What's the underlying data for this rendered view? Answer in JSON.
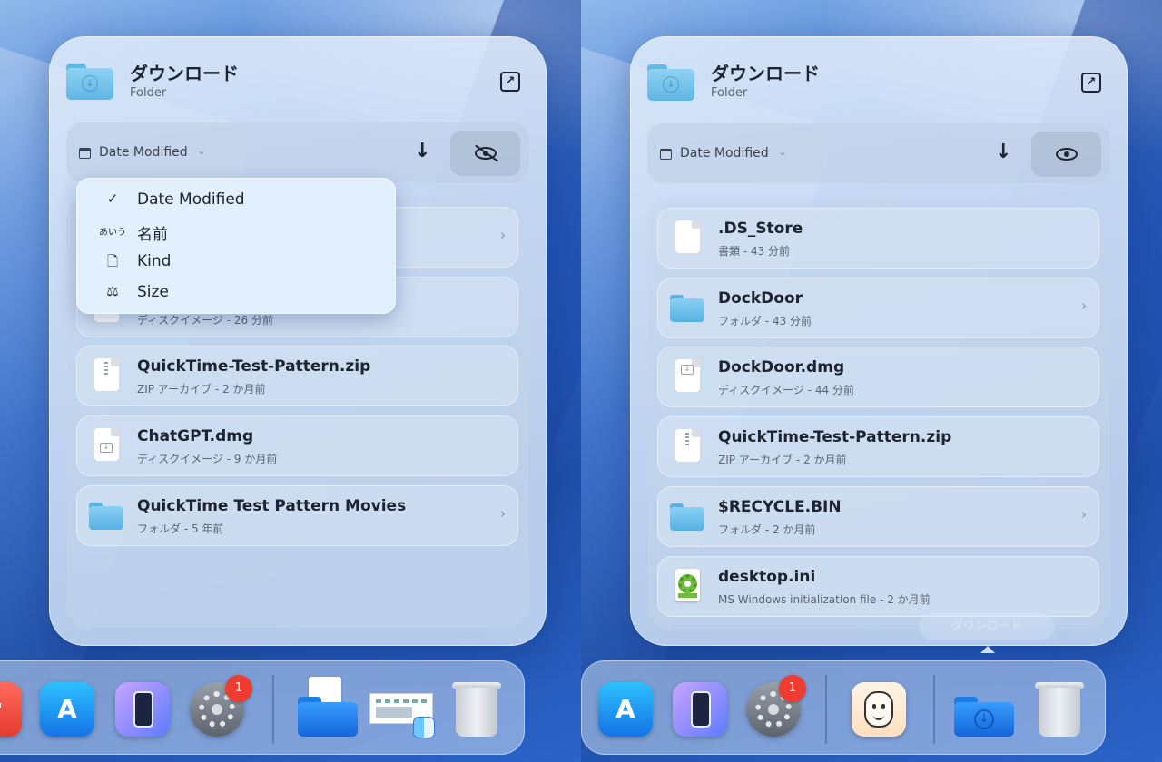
{
  "left": {
    "panel": {
      "title": "ダウンロード",
      "subtitle": "Folder",
      "open_icon": "open-in-finder-icon"
    },
    "toolbar": {
      "sort_label": "Date Modified",
      "sort_direction_glyph": "↓",
      "visibility_icon": "eye-slash-icon"
    },
    "sort_menu": {
      "items": [
        {
          "glyph": "✓",
          "label": "Date Modified",
          "icon": "checkmark-icon",
          "selected": true
        },
        {
          "glyph": "あいう",
          "label": "名前",
          "icon": "hiragana-icon"
        },
        {
          "glyph": "🗋",
          "label": "Kind",
          "icon": "document-icon"
        },
        {
          "glyph": "⚖",
          "label": "Size",
          "icon": "weight-icon"
        }
      ]
    },
    "files": [
      {
        "name": "",
        "meta": "",
        "icon": "hidden-row",
        "has_chevron": true
      },
      {
        "name": "",
        "meta": "ディスクイメージ - 26 分前",
        "icon": "disk-image-icon",
        "has_chevron": false
      },
      {
        "name": "QuickTime-Test-Pattern.zip",
        "meta": "ZIP アーカイブ - 2 か月前",
        "icon": "zip-file-icon",
        "has_chevron": false
      },
      {
        "name": "ChatGPT.dmg",
        "meta": "ディスクイメージ - 9 か月前",
        "icon": "disk-image-icon",
        "has_chevron": false
      },
      {
        "name": "QuickTime Test Pattern Movies",
        "meta": "フォルダ - 5 年前",
        "icon": "folder-icon",
        "has_chevron": true
      }
    ],
    "dock": {
      "items": [
        "rocket-app-icon",
        "app-store-icon",
        "iphone-mirroring-icon",
        "system-settings-icon",
        "downloads-stack-icon",
        "screenshot-stack-icon",
        "trash-icon"
      ],
      "settings_badge": "1"
    }
  },
  "right": {
    "panel": {
      "title": "ダウンロード",
      "subtitle": "Folder",
      "open_icon": "open-in-finder-icon"
    },
    "toolbar": {
      "sort_label": "Date Modified",
      "sort_direction_glyph": "↓",
      "visibility_icon": "eye-icon"
    },
    "files": [
      {
        "name": ".DS_Store",
        "meta": "書類 - 43 分前",
        "icon": "document-icon",
        "has_chevron": false
      },
      {
        "name": "DockDoor",
        "meta": "フォルダ - 43 分前",
        "icon": "folder-icon",
        "has_chevron": true
      },
      {
        "name": "DockDoor.dmg",
        "meta": "ディスクイメージ - 44 分前",
        "icon": "disk-image-icon",
        "has_chevron": false
      },
      {
        "name": "QuickTime-Test-Pattern.zip",
        "meta": "ZIP アーカイブ - 2 か月前",
        "icon": "zip-file-icon",
        "has_chevron": false
      },
      {
        "name": "$RECYCLE.BIN",
        "meta": "フォルダ - 2 か月前",
        "icon": "folder-icon",
        "has_chevron": true
      },
      {
        "name": "desktop.ini",
        "meta": "MS Windows initialization file - 2 か月前",
        "icon": "settings-file-icon",
        "has_chevron": false
      }
    ],
    "dock": {
      "items": [
        "app-store-icon",
        "iphone-mirroring-icon",
        "system-settings-icon",
        "memoji-app-icon",
        "downloads-folder-icon",
        "trash-icon"
      ],
      "settings_badge": "1",
      "hover_label": "ダウンロード"
    }
  },
  "colors": {
    "accent_folder": "#5fb6e4",
    "badge": "#ef3b30",
    "text_primary": "#1d2430",
    "text_secondary": "#5a6575"
  }
}
